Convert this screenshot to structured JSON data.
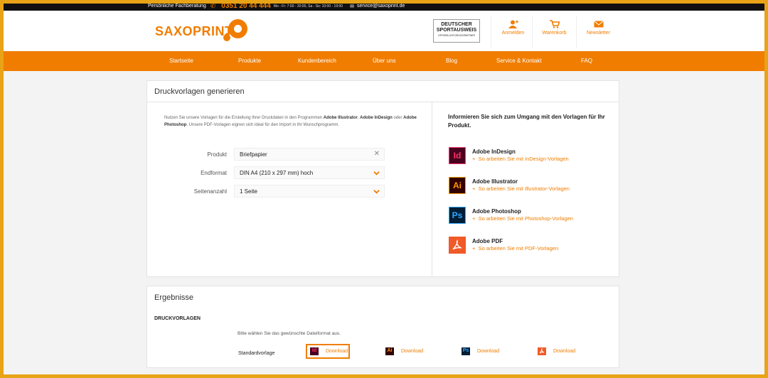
{
  "topbar": {
    "consultation": "Persönliche Fachberatung",
    "phone": "0351 20 44 444",
    "hours": "Mo - Fr: 7:00 - 20:00, Sa - So: 10:00 - 19:00",
    "email": "service@saxoprint.de"
  },
  "header": {
    "logo": "SAXOPRINT",
    "badge_line1": "DEUTSCHER",
    "badge_line2": "SPORTAUSWEIS",
    "badge_sub": "OFFIZIELLER DRUCKPARTNER",
    "links": [
      {
        "label": "Anmelden",
        "icon": "user-add-icon"
      },
      {
        "label": "Warenkorb",
        "icon": "cart-icon"
      },
      {
        "label": "Newsletter",
        "icon": "envelope-icon"
      }
    ]
  },
  "nav": {
    "items": [
      "Startseite",
      "Produkte",
      "Kundenbereich",
      "Über uns",
      "Blog",
      "Service & Kontakt",
      "FAQ"
    ]
  },
  "generator": {
    "title": "Druckvorlagen generieren",
    "intro_part1": "Nutzen Sie unsere Vorlagen für die Erstellung Ihrer Druckdaten in den Programmen ",
    "intro_bold1": "Adobe Illustrator",
    "intro_part2": ", ",
    "intro_bold2": "Adobe InDesign",
    "intro_part3": " oder ",
    "intro_bold3": "Adobe Photoshop",
    "intro_part4": ". Unsere PDF-Vorlagen eignen sich ideal für den Import in Ihr Wunschprogramm.",
    "fields": [
      {
        "label": "Produkt",
        "value": "Briefpapier",
        "icon": "clear-icon"
      },
      {
        "label": "Endformat",
        "value": "DIN A4 (210 x 297 mm) hoch",
        "icon": "chevron-down-icon"
      },
      {
        "label": "Seitenanzahl",
        "value": "1 Seite",
        "icon": "chevron-down-icon"
      }
    ],
    "info_title": "Informieren Sie sich zum Umgang mit den Vorlagen für Ihr Produkt.",
    "programs": [
      {
        "abbr": "Id",
        "name": "Adobe InDesign",
        "link": "So arbeiten Sie mit InDesign-Vorlagen",
        "bg": "#49021f",
        "fg": "#ff3366"
      },
      {
        "abbr": "Ai",
        "name": "Adobe Illustrator",
        "link": "So arbeiten Sie mit Illustrator-Vorlagen",
        "bg": "#330000",
        "fg": "#ff9a00"
      },
      {
        "abbr": "Ps",
        "name": "Adobe Photoshop",
        "link": "So arbeiten Sie mit Photoshop-Vorlagen",
        "bg": "#001e36",
        "fg": "#31a8ff"
      },
      {
        "abbr": "",
        "name": "Adobe PDF",
        "link": "So arbeiten Sie mit PDF-Vorlagen",
        "bg": "#f05a28",
        "fg": "#ffffff"
      }
    ]
  },
  "results": {
    "title": "Ergebnisse",
    "subtitle": "DRUCKVORLAGEN",
    "hint": "Bitte wählen Sie das gewünschte Dateiformat aus.",
    "row_label": "Standardvorlage",
    "downloads": [
      {
        "abbr": "Id",
        "label": "Download",
        "active": true,
        "bg": "#49021f",
        "fg": "#ff3366"
      },
      {
        "abbr": "Ai",
        "label": "Download",
        "active": false,
        "bg": "#330000",
        "fg": "#ff9a00"
      },
      {
        "abbr": "Ps",
        "label": "Download",
        "active": false,
        "bg": "#001e36",
        "fg": "#31a8ff"
      },
      {
        "abbr": "",
        "label": "Download",
        "active": false,
        "bg": "#f05a28",
        "fg": "#ffffff"
      }
    ]
  },
  "colors": {
    "accent": "#f07d00",
    "frame": "#e8a317"
  }
}
